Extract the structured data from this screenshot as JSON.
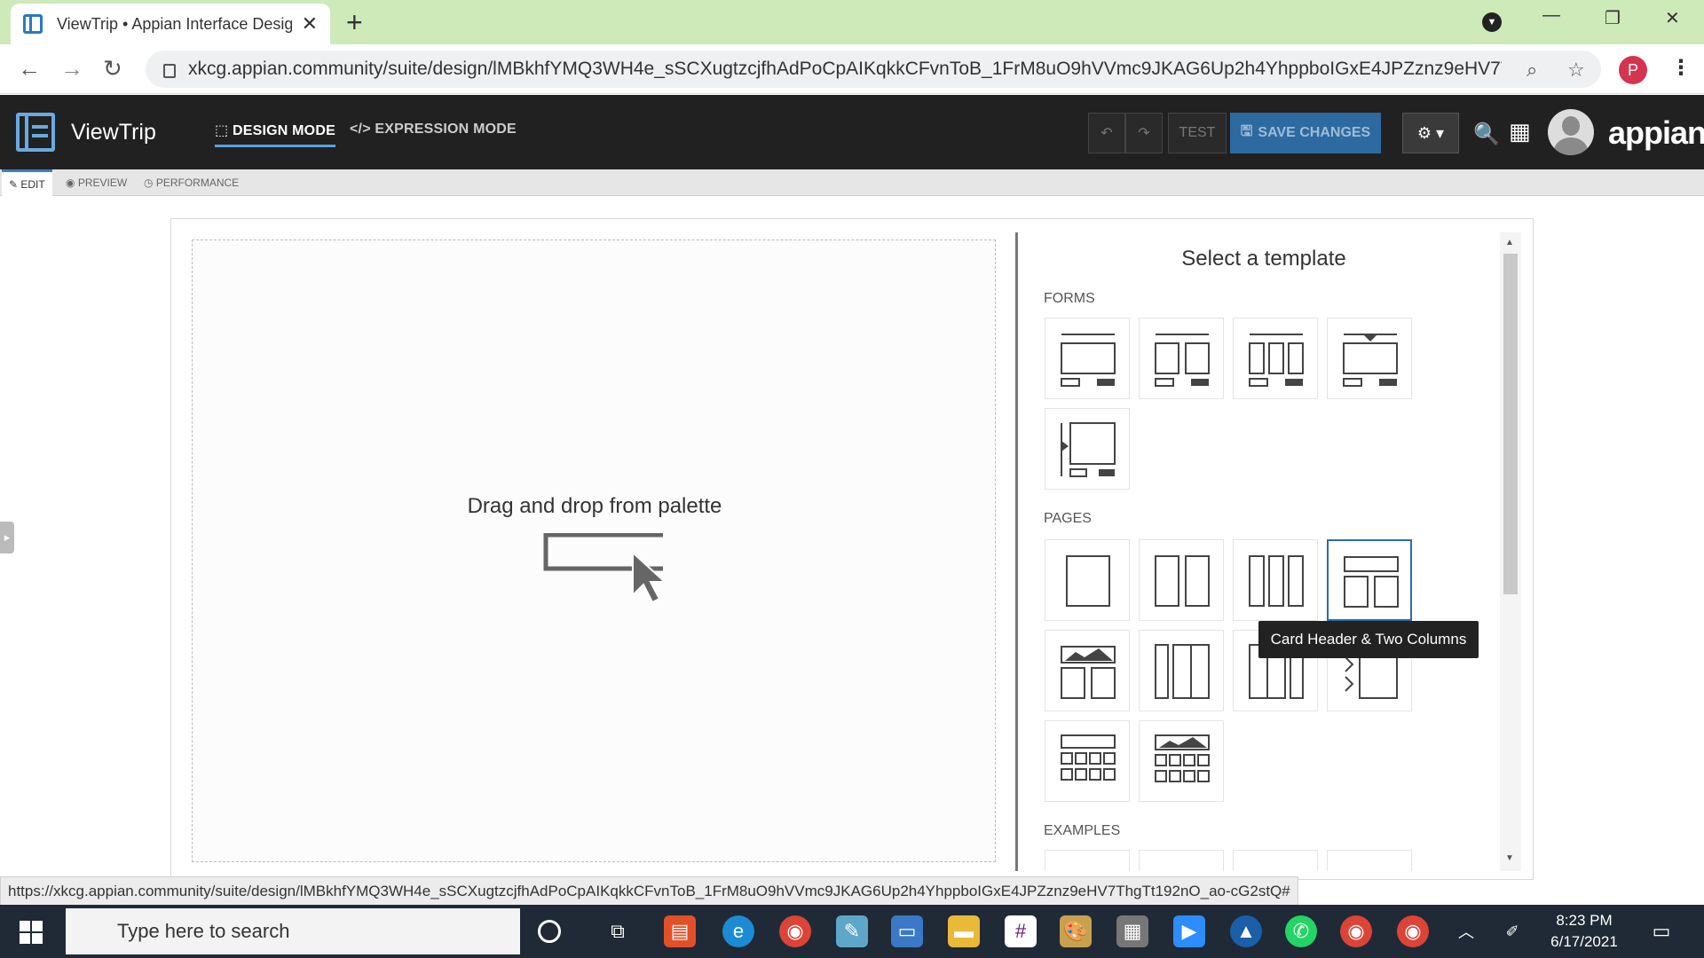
{
  "browser": {
    "tab_title": "ViewTrip • Appian Interface Desig",
    "url": "xkcg.appian.community/suite/design/lMBkhfYMQ3WH4e_sSCXugtzcjfhAdPoCpAIKqkkCFvnToB_1FrM8uO9hVVmc9JKAG6Up2h4YhppboIGxE4JPZznz9eHV7Thg...",
    "profile_initial": "P"
  },
  "appbar": {
    "app_name": "ViewTrip",
    "design_mode": "DESIGN MODE",
    "expression_mode": "EXPRESSION MODE",
    "test": "TEST",
    "save_changes": "SAVE CHANGES",
    "brand": "appian"
  },
  "subtabs": {
    "edit": "EDIT",
    "preview": "PREVIEW",
    "performance": "PERFORMANCE"
  },
  "canvas": {
    "drop_text": "Drag and drop from palette"
  },
  "templates": {
    "title": "Select a template",
    "forms_label": "FORMS",
    "pages_label": "PAGES",
    "examples_label": "EXAMPLES",
    "tooltip": "Card Header & Two Columns",
    "forms": [
      "form-one-column",
      "form-two-columns",
      "form-three-columns",
      "form-wizard",
      "form-sidebar"
    ],
    "pages": [
      "page-one-column",
      "page-two-columns",
      "page-three-columns",
      "page-card-header-two-columns",
      "page-image-header-two-columns",
      "page-sidebar-columns",
      "page-column-sidebar",
      "page-navigation",
      "page-grid",
      "page-image-header-grid"
    ]
  },
  "status_url": "https://xkcg.appian.community/suite/design/lMBkhfYMQ3WH4e_sSCXugtzcjfhAdPoCpAIKqkkCFvnToB_1FrM8uO9hVVmc9JKAG6Up2h4YhppboIGxE4JPZznz9eHV7ThgTt192nO_ao-cG2stQ#",
  "taskbar": {
    "search_placeholder": "Type here to search",
    "time": "8:23 PM",
    "date": "6/17/2021"
  }
}
